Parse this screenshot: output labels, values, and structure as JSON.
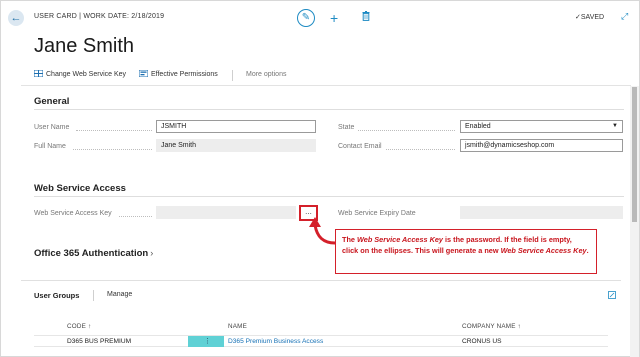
{
  "header": {
    "caption": "USER CARD | WORK DATE: 2/18/2019",
    "saved_label": "SAVED",
    "title": "Jane Smith"
  },
  "actions": {
    "change_key": "Change Web Service Key",
    "effective_permissions": "Effective Permissions",
    "more_options": "More options"
  },
  "general": {
    "title": "General",
    "user_name_label": "User Name",
    "user_name_value": "JSMITH",
    "full_name_label": "Full Name",
    "full_name_value": "Jane Smith",
    "state_label": "State",
    "state_value": "Enabled",
    "email_label": "Contact Email",
    "email_value": "jsmith@dynamicseshop.com"
  },
  "web_service": {
    "title": "Web Service Access",
    "key_label": "Web Service Access Key",
    "key_button": "...",
    "expiry_label": "Web Service Expiry Date"
  },
  "callout": {
    "part1": "The ",
    "italic1": "Web Service Access Key",
    "part2": " is the password. If the field is empty, click on the ellipses. This will generate a new ",
    "italic2": "Web Service Access Key",
    "part3": "."
  },
  "o365": {
    "title": "Office 365 Authentication",
    "chevron": "›"
  },
  "user_groups": {
    "title": "User Groups",
    "manage": "Manage",
    "columns": [
      "CODE ↑",
      "NAME",
      "COMPANY NAME ↑"
    ],
    "rows": [
      {
        "code": "D365 BUS PREMIUM",
        "name": "D365 Premium Business Access",
        "company": "CRONUS US"
      }
    ]
  },
  "colors": {
    "accent": "#1e8bc3",
    "callout_red": "#d4202a",
    "row_marker": "#5fd1d5"
  }
}
